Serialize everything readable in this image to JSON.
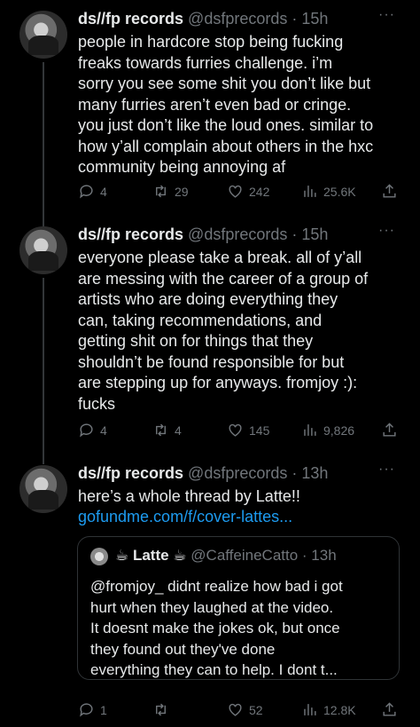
{
  "tweets": [
    {
      "name": "ds//fp records",
      "handle": "@dsfprecords",
      "sep": " · ",
      "time": "15h",
      "text": "people in hardcore stop being fucking\nfreaks towards furries challenge. i’m\nsorry you see some shit you don’t like but\nmany furries aren’t even bad or cringe.\nyou just don’t like the loud ones. similar to\nhow y’all complain about others in the hxc\ncommunity being annoying af",
      "replies": "4",
      "retweets": "29",
      "likes": "242",
      "views": "25.6K"
    },
    {
      "name": "ds//fp records",
      "handle": "@dsfprecords",
      "sep": " · ",
      "time": "15h",
      "text": "everyone please take a break. all of y’all\nare messing with the career of a group of\nartists who are doing everything they\ncan, taking recommendations, and\ngetting shit on for things that they\nshouldn’t be found responsible for but\nare stepping up for anyways. fromjoy :):\nfucks",
      "replies": "4",
      "retweets": "4",
      "likes": "145",
      "views": "9,826"
    },
    {
      "name": "ds//fp records",
      "handle": "@dsfprecords",
      "sep": " · ",
      "time": "13h",
      "text": "here’s a whole thread by Latte!!",
      "link": "gofundme.com/f/cover-lattes...",
      "quote": {
        "name": "☕ Latte ☕",
        "handle": "@CaffeineCatto",
        "sep": " · ",
        "time": "13h",
        "text": "@fromjoy_ didnt realize how bad i got\nhurt when they laughed at the video.\nIt doesnt make the jokes ok, but once\nthey found out they've done\neverything they can to help. I dont t..."
      },
      "replies": "1",
      "retweets": "",
      "likes": "52",
      "views": "12.8K"
    }
  ],
  "more_glyph": "···",
  "colors": {
    "background": "#000000",
    "text": "#e7e9ea",
    "muted": "#71767b",
    "link": "#1d9bf0"
  },
  "icons": [
    "reply-icon",
    "retweet-icon",
    "like-icon",
    "views-icon",
    "share-icon"
  ]
}
